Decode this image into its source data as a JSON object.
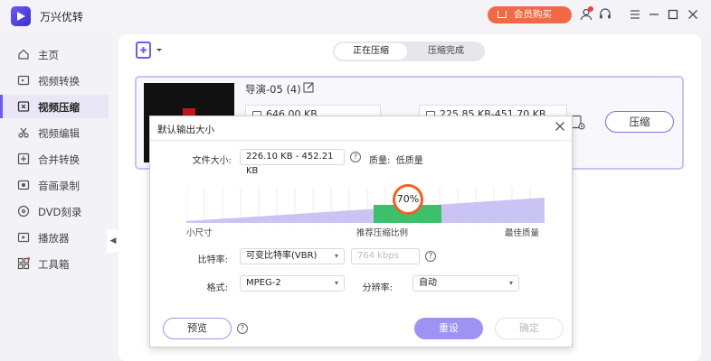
{
  "app": {
    "title": "万兴优转",
    "vip_label": "会员购买"
  },
  "sidebar": {
    "items": [
      {
        "label": "主页",
        "icon": "home-icon"
      },
      {
        "label": "视频转换",
        "icon": "convert-icon"
      },
      {
        "label": "视频压缩",
        "icon": "compress-icon",
        "active": true
      },
      {
        "label": "视频编辑",
        "icon": "scissors-icon"
      },
      {
        "label": "合并转换",
        "icon": "merge-icon"
      },
      {
        "label": "音画录制",
        "icon": "record-icon"
      },
      {
        "label": "DVD刻录",
        "icon": "disc-icon"
      },
      {
        "label": "播放器",
        "icon": "player-icon"
      },
      {
        "label": "工具箱",
        "icon": "toolbox-icon"
      }
    ]
  },
  "tabs": {
    "compressing": "正在压缩",
    "done": "压缩完成"
  },
  "file": {
    "name": "导演-05 (4)",
    "original_size": "646.00 KB",
    "target_size": "225.85 KB-451.70 KB",
    "compress_label": "压缩"
  },
  "dialog": {
    "title": "默认输出大小",
    "size_label": "文件大小:",
    "size_value": "226.10 KB - 452.21 KB",
    "quality_label": "质量:",
    "quality_value": "低质量",
    "ratio_percent": 70,
    "ratio_text": "70%",
    "low_label": "小尺寸",
    "mid_label": "推荐压缩比例",
    "high_label": "最佳质量",
    "bitrate_label": "比特率:",
    "bitrate_value": "可变比特率(VBR)",
    "kbps_placeholder": "764 kbps",
    "format_label": "格式:",
    "format_value": "MPEG-2",
    "resolution_label": "分辨率:",
    "resolution_value": "自动",
    "preview_label": "预览",
    "reset_label": "重设",
    "ok_label": "确定"
  },
  "colors": {
    "accent": "#6b5cf6",
    "orange": "#f2611f",
    "green": "#3cc06a",
    "bar": "#c9c4f4"
  }
}
